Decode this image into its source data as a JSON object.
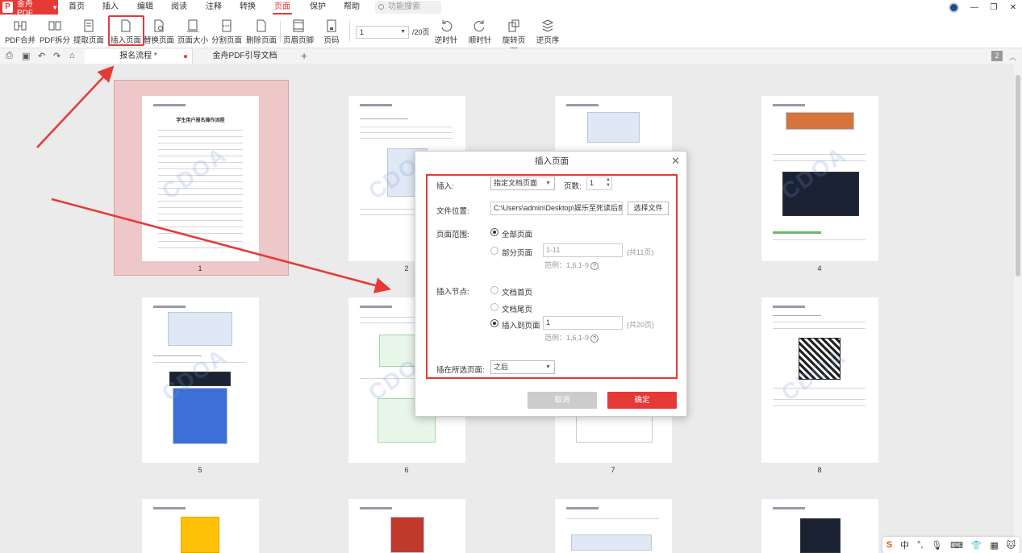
{
  "app": {
    "name": "金舟PDF",
    "logo_letter": "P"
  },
  "menu": [
    "首页",
    "插入",
    "编辑",
    "阅读",
    "注释",
    "转换",
    "页面",
    "保护",
    "帮助"
  ],
  "menu_active": "页面",
  "search_placeholder": "功能搜索",
  "toolbar": {
    "tools": [
      "PDF合并",
      "PDF拆分",
      "提取页面",
      "插入页面",
      "替换页面",
      "页面大小",
      "分割页面",
      "删除页面",
      "页眉页脚",
      "页码",
      "逆时针",
      "顺时针",
      "旋转页面",
      "逆页序"
    ],
    "page_select": "1",
    "page_total": "/20页"
  },
  "tabs": {
    "active": "报名流程 *",
    "second": "金舟PDF引导文档",
    "add": "+",
    "badge": "2"
  },
  "thumbnails": {
    "page_numbers": [
      "1",
      "2",
      "3",
      "4",
      "5",
      "6",
      "7",
      "8"
    ],
    "watermark": "CDOA",
    "page1_title": "学生用户报名操作流程"
  },
  "dialog": {
    "title": "插入页面",
    "close": "✕",
    "insert_label": "插入:",
    "insert_value": "指定文档页面",
    "pages_label": "页数:",
    "pages_value": "1",
    "file_label": "文件位置:",
    "file_value": "C:\\Users\\admin\\Desktop\\娱乐至死读后感.p",
    "choose_file": "选择文件",
    "range_label": "页面范围:",
    "all_pages": "全部页面",
    "some_pages": "部分页面",
    "range_value": "1-11",
    "range_total": "(共11页)",
    "example": "范例：1,6,1-9",
    "node_label": "插入节点:",
    "doc_first": "文档首页",
    "doc_last": "文档尾页",
    "insert_to": "插入到页面",
    "insert_to_value": "1",
    "insert_to_total": "(共20页)",
    "position_label": "插在所选页面:",
    "position_value": "之后",
    "cancel": "取消",
    "ok": "确定"
  },
  "ime": {
    "s_icon": "S",
    "lang": "中",
    "punct": "°,"
  },
  "colors": {
    "accent": "#e53935",
    "selection": "#eec8c8"
  }
}
